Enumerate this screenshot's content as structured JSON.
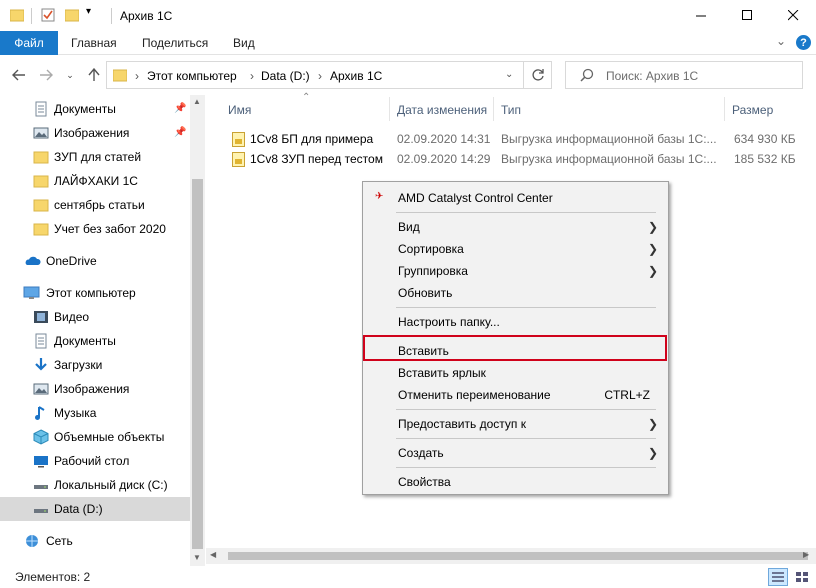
{
  "window": {
    "title": "Архив 1С"
  },
  "ribbon": {
    "file": "Файл",
    "tabs": [
      "Главная",
      "Поделиться",
      "Вид"
    ]
  },
  "address": {
    "segments": [
      "Этот компьютер",
      "Data (D:)",
      "Архив 1С"
    ],
    "search_placeholder": "Поиск: Архив 1С"
  },
  "sidebar": {
    "quick": [
      {
        "label": "Документы",
        "icon": "documents-icon",
        "pinned": true
      },
      {
        "label": "Изображения",
        "icon": "pictures-icon",
        "pinned": true
      },
      {
        "label": "ЗУП для статей",
        "icon": "folder-icon"
      },
      {
        "label": "ЛАЙФХАКИ 1С",
        "icon": "folder-icon"
      },
      {
        "label": "сентябрь статьи",
        "icon": "folder-icon"
      },
      {
        "label": "Учет без забот 2020",
        "icon": "folder-icon"
      }
    ],
    "onedrive": "OneDrive",
    "computer": "Этот компьютер",
    "computer_items": [
      {
        "label": "Видео",
        "icon": "video-icon"
      },
      {
        "label": "Документы",
        "icon": "documents-icon"
      },
      {
        "label": "Загрузки",
        "icon": "downloads-icon"
      },
      {
        "label": "Изображения",
        "icon": "pictures-icon"
      },
      {
        "label": "Музыка",
        "icon": "music-icon"
      },
      {
        "label": "Объемные объекты",
        "icon": "3d-objects-icon"
      },
      {
        "label": "Рабочий стол",
        "icon": "desktop-icon"
      },
      {
        "label": "Локальный диск (C:)",
        "icon": "drive-icon"
      },
      {
        "label": "Data (D:)",
        "icon": "drive-icon",
        "selected": true
      }
    ],
    "network": "Сеть"
  },
  "columns": [
    "Имя",
    "Дата изменения",
    "Тип",
    "Размер"
  ],
  "files": [
    {
      "name": "1Cv8 БП для примера",
      "date": "02.09.2020 14:31",
      "type": "Выгрузка информационной базы 1С:...",
      "size": "634 930 КБ"
    },
    {
      "name": "1Cv8 ЗУП перед тестом",
      "date": "02.09.2020 14:29",
      "type": "Выгрузка информационной базы 1С:...",
      "size": "185 532 КБ"
    }
  ],
  "context_menu": {
    "amd": "AMD Catalyst Control Center",
    "view": "Вид",
    "sort": "Сортировка",
    "group": "Группировка",
    "refresh": "Обновить",
    "customize": "Настроить папку...",
    "paste": "Вставить",
    "paste_shortcut": "Вставить ярлык",
    "undo_rename": "Отменить переименование",
    "undo_shortcut": "CTRL+Z",
    "share": "Предоставить доступ к",
    "create": "Создать",
    "properties": "Свойства"
  },
  "status": {
    "items": "Элементов: 2"
  },
  "colors": {
    "accent": "#1979ca",
    "highlight_box": "#d0021b",
    "selected_bg": "#cce8ff"
  }
}
